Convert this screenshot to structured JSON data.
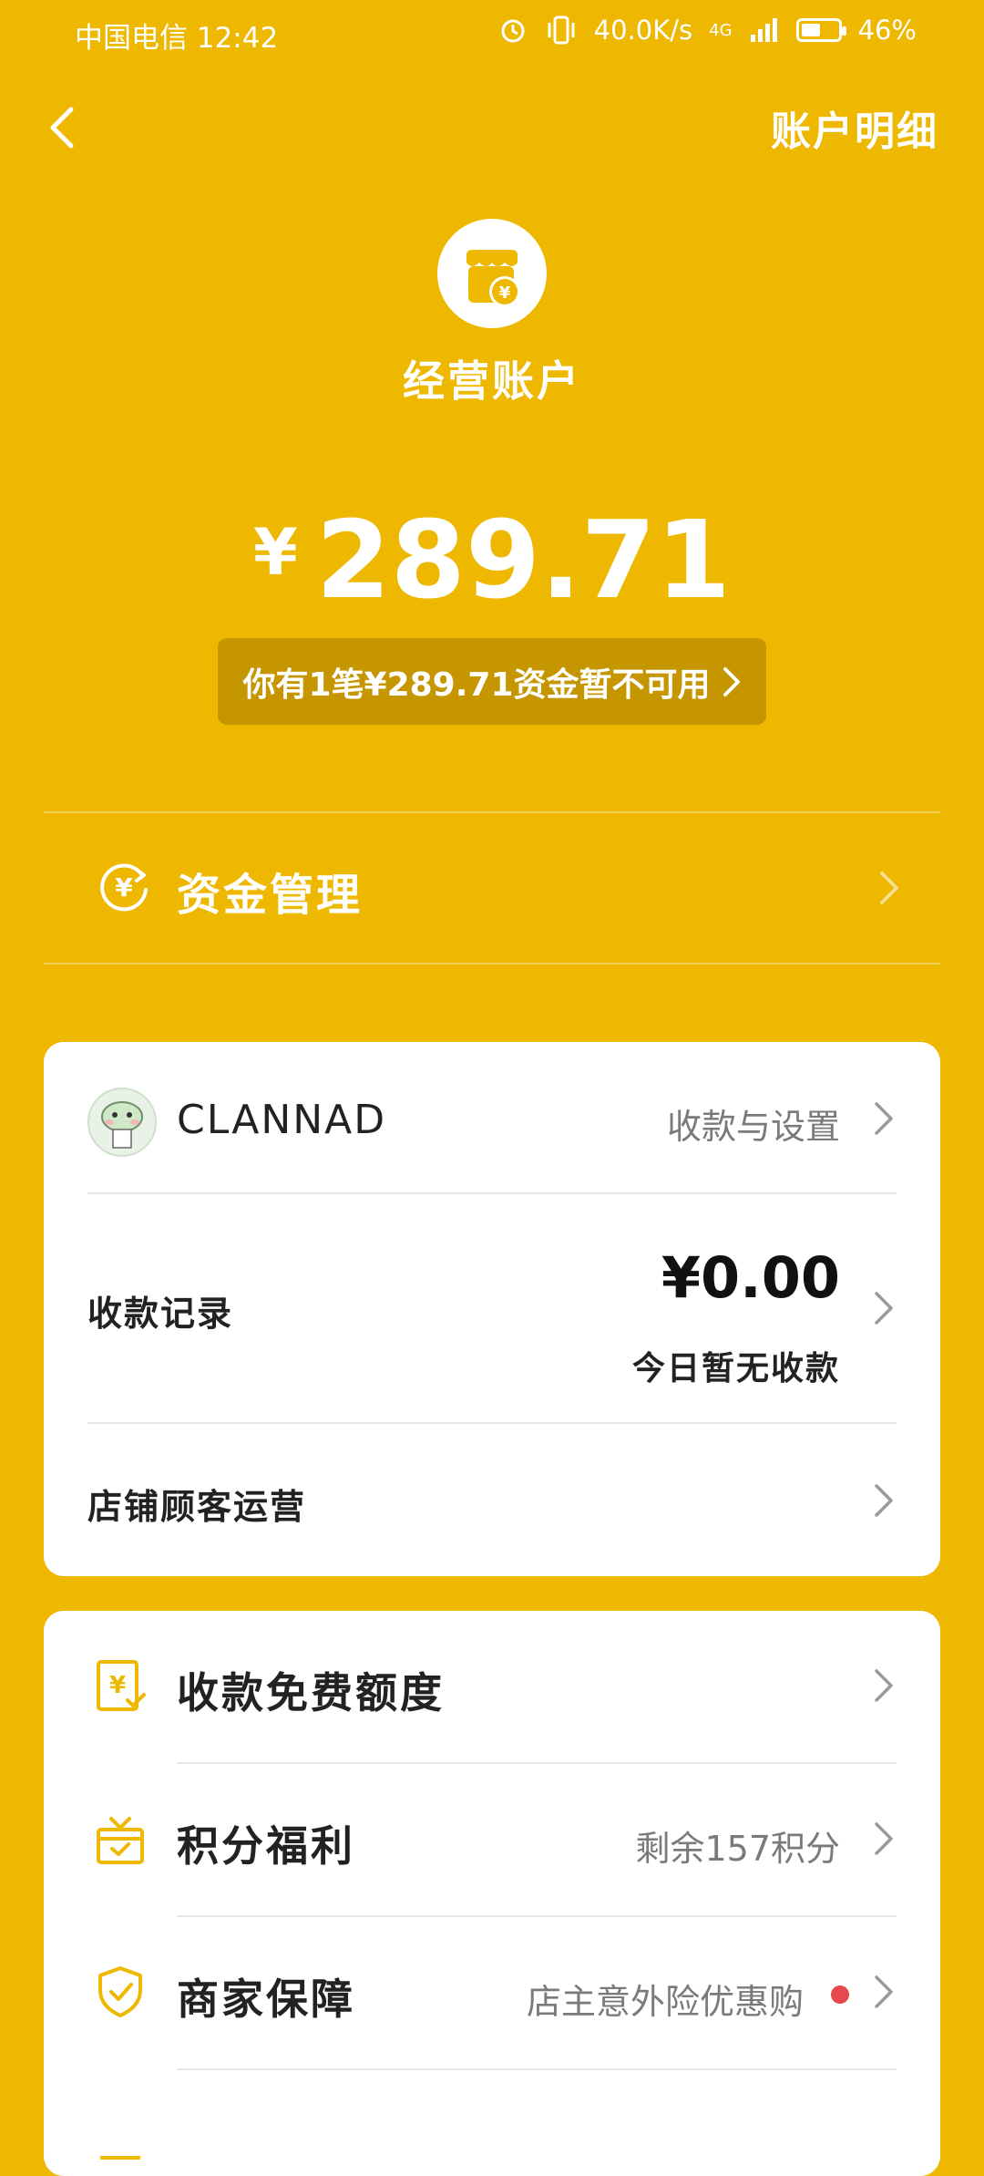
{
  "status_bar": {
    "carrier_time": "中国电信 12:42",
    "net_speed": "40.0K/s",
    "signal": "4G",
    "battery": "46%"
  },
  "nav": {
    "back_icon": "chevron-left-icon",
    "detail_link": "账户明细"
  },
  "account": {
    "icon": "shop-yen-icon",
    "title": "经营账户",
    "currency": "¥",
    "balance": "289.71",
    "notice": "你有1笔¥289.71资金暂不可用"
  },
  "fund_management": {
    "icon": "yen-cycle-icon",
    "label": "资金管理"
  },
  "card1": {
    "username": "CLANNAD",
    "settings_link": "收款与设置",
    "records_label": "收款记录",
    "records_amount": "¥0.00",
    "records_note": "今日暂无收款",
    "customer_ops_label": "店铺顾客运营"
  },
  "card2": {
    "items": [
      {
        "icon": "fee-free-icon",
        "label": "收款免费额度",
        "right": ""
      },
      {
        "icon": "gift-icon",
        "label": "积分福利",
        "right": "剩余157积分"
      },
      {
        "icon": "shield-check-icon",
        "label": "商家保障",
        "right": "店主意外险优惠购"
      }
    ]
  },
  "colors": {
    "brand_yellow": "#EEB700",
    "notice_bg": "#C59600",
    "red_dot": "#E5484D"
  }
}
